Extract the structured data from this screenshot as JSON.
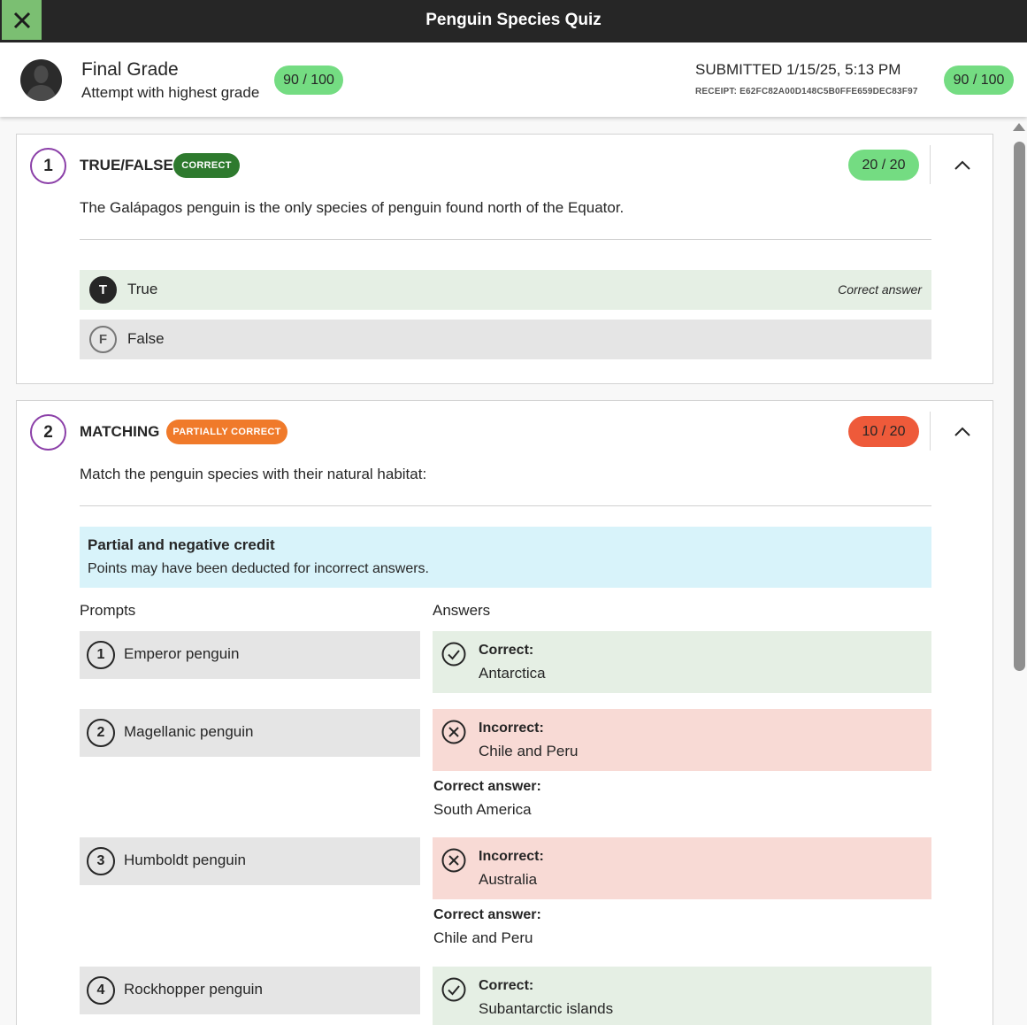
{
  "window": {
    "title": "Penguin Species Quiz",
    "close_icon": "close-icon",
    "close_button_color": "#7bbf72"
  },
  "header": {
    "grade_title": "Final Grade",
    "grade_subtitle": "Attempt with highest grade",
    "grade_score": "90 / 100",
    "submitted": "SUBMITTED 1/15/25, 5:13 PM",
    "receipt": "RECEIPT: E62FC82A00D148C5B0FFE659DEC83F97",
    "submission_score": "90 / 100"
  },
  "colors": {
    "score_green": "#74dc82",
    "score_red": "#ee5a3a",
    "badge_correct": "#2e7a2e",
    "badge_partial": "#f07a2a",
    "question_ring": "#8b3fa8",
    "correct_bg": "#e5efe4",
    "incorrect_bg": "#f8dad5",
    "info_bg": "#d8f3fa"
  },
  "questions": [
    {
      "number": "1",
      "type": "TRUE/FALSE",
      "status": "CORRECT",
      "score": "20 / 20",
      "text": "The Galápagos penguin is the only species of penguin found north of the Equator.",
      "options": [
        {
          "letter": "T",
          "label": "True",
          "note": "Correct answer",
          "selected": true
        },
        {
          "letter": "F",
          "label": "False",
          "note": "",
          "selected": false
        }
      ]
    },
    {
      "number": "2",
      "type": "MATCHING",
      "status": "PARTIALLY CORRECT",
      "score": "10 / 20",
      "text": "Match the penguin species with their natural habitat:",
      "info_title": "Partial and negative credit",
      "info_text": "Points may have been deducted for incorrect answers.",
      "prompts_header": "Prompts",
      "answers_header": "Answers",
      "rows": [
        {
          "num": "1",
          "prompt": "Emperor penguin",
          "result": "Correct:",
          "answer": "Antarctica",
          "correct_label": "",
          "correct_value": ""
        },
        {
          "num": "2",
          "prompt": "Magellanic penguin",
          "result": "Incorrect:",
          "answer": "Chile and Peru",
          "correct_label": "Correct answer:",
          "correct_value": "South America"
        },
        {
          "num": "3",
          "prompt": "Humboldt penguin",
          "result": "Incorrect:",
          "answer": "Australia",
          "correct_label": "Correct answer:",
          "correct_value": "Chile and Peru"
        },
        {
          "num": "4",
          "prompt": "Rockhopper penguin",
          "result": "Correct:",
          "answer": "Subantarctic islands",
          "correct_label": "",
          "correct_value": ""
        }
      ]
    }
  ]
}
